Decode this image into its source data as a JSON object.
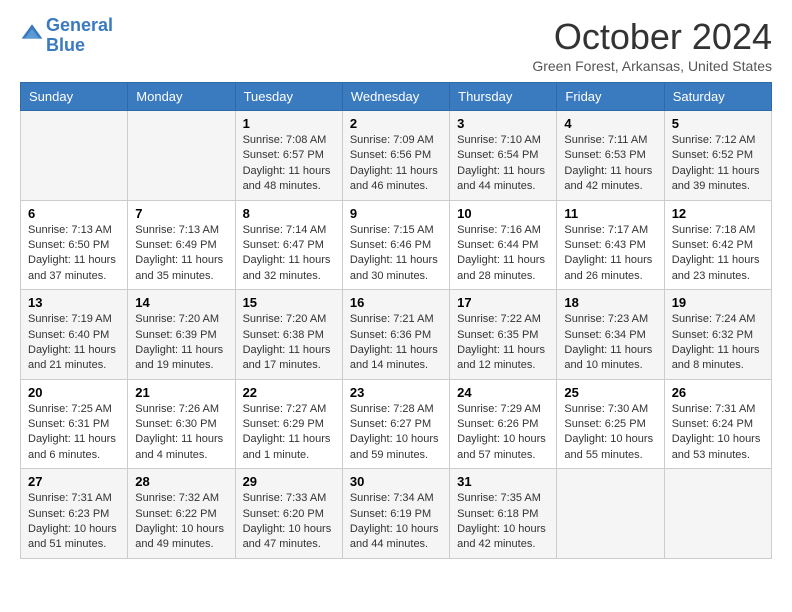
{
  "header": {
    "logo_line1": "General",
    "logo_line2": "Blue",
    "month_title": "October 2024",
    "location": "Green Forest, Arkansas, United States"
  },
  "days_of_week": [
    "Sunday",
    "Monday",
    "Tuesday",
    "Wednesday",
    "Thursday",
    "Friday",
    "Saturday"
  ],
  "weeks": [
    [
      {
        "day": "",
        "info": ""
      },
      {
        "day": "",
        "info": ""
      },
      {
        "day": "1",
        "info": "Sunrise: 7:08 AM\nSunset: 6:57 PM\nDaylight: 11 hours and 48 minutes."
      },
      {
        "day": "2",
        "info": "Sunrise: 7:09 AM\nSunset: 6:56 PM\nDaylight: 11 hours and 46 minutes."
      },
      {
        "day": "3",
        "info": "Sunrise: 7:10 AM\nSunset: 6:54 PM\nDaylight: 11 hours and 44 minutes."
      },
      {
        "day": "4",
        "info": "Sunrise: 7:11 AM\nSunset: 6:53 PM\nDaylight: 11 hours and 42 minutes."
      },
      {
        "day": "5",
        "info": "Sunrise: 7:12 AM\nSunset: 6:52 PM\nDaylight: 11 hours and 39 minutes."
      }
    ],
    [
      {
        "day": "6",
        "info": "Sunrise: 7:13 AM\nSunset: 6:50 PM\nDaylight: 11 hours and 37 minutes."
      },
      {
        "day": "7",
        "info": "Sunrise: 7:13 AM\nSunset: 6:49 PM\nDaylight: 11 hours and 35 minutes."
      },
      {
        "day": "8",
        "info": "Sunrise: 7:14 AM\nSunset: 6:47 PM\nDaylight: 11 hours and 32 minutes."
      },
      {
        "day": "9",
        "info": "Sunrise: 7:15 AM\nSunset: 6:46 PM\nDaylight: 11 hours and 30 minutes."
      },
      {
        "day": "10",
        "info": "Sunrise: 7:16 AM\nSunset: 6:44 PM\nDaylight: 11 hours and 28 minutes."
      },
      {
        "day": "11",
        "info": "Sunrise: 7:17 AM\nSunset: 6:43 PM\nDaylight: 11 hours and 26 minutes."
      },
      {
        "day": "12",
        "info": "Sunrise: 7:18 AM\nSunset: 6:42 PM\nDaylight: 11 hours and 23 minutes."
      }
    ],
    [
      {
        "day": "13",
        "info": "Sunrise: 7:19 AM\nSunset: 6:40 PM\nDaylight: 11 hours and 21 minutes."
      },
      {
        "day": "14",
        "info": "Sunrise: 7:20 AM\nSunset: 6:39 PM\nDaylight: 11 hours and 19 minutes."
      },
      {
        "day": "15",
        "info": "Sunrise: 7:20 AM\nSunset: 6:38 PM\nDaylight: 11 hours and 17 minutes."
      },
      {
        "day": "16",
        "info": "Sunrise: 7:21 AM\nSunset: 6:36 PM\nDaylight: 11 hours and 14 minutes."
      },
      {
        "day": "17",
        "info": "Sunrise: 7:22 AM\nSunset: 6:35 PM\nDaylight: 11 hours and 12 minutes."
      },
      {
        "day": "18",
        "info": "Sunrise: 7:23 AM\nSunset: 6:34 PM\nDaylight: 11 hours and 10 minutes."
      },
      {
        "day": "19",
        "info": "Sunrise: 7:24 AM\nSunset: 6:32 PM\nDaylight: 11 hours and 8 minutes."
      }
    ],
    [
      {
        "day": "20",
        "info": "Sunrise: 7:25 AM\nSunset: 6:31 PM\nDaylight: 11 hours and 6 minutes."
      },
      {
        "day": "21",
        "info": "Sunrise: 7:26 AM\nSunset: 6:30 PM\nDaylight: 11 hours and 4 minutes."
      },
      {
        "day": "22",
        "info": "Sunrise: 7:27 AM\nSunset: 6:29 PM\nDaylight: 11 hours and 1 minute."
      },
      {
        "day": "23",
        "info": "Sunrise: 7:28 AM\nSunset: 6:27 PM\nDaylight: 10 hours and 59 minutes."
      },
      {
        "day": "24",
        "info": "Sunrise: 7:29 AM\nSunset: 6:26 PM\nDaylight: 10 hours and 57 minutes."
      },
      {
        "day": "25",
        "info": "Sunrise: 7:30 AM\nSunset: 6:25 PM\nDaylight: 10 hours and 55 minutes."
      },
      {
        "day": "26",
        "info": "Sunrise: 7:31 AM\nSunset: 6:24 PM\nDaylight: 10 hours and 53 minutes."
      }
    ],
    [
      {
        "day": "27",
        "info": "Sunrise: 7:31 AM\nSunset: 6:23 PM\nDaylight: 10 hours and 51 minutes."
      },
      {
        "day": "28",
        "info": "Sunrise: 7:32 AM\nSunset: 6:22 PM\nDaylight: 10 hours and 49 minutes."
      },
      {
        "day": "29",
        "info": "Sunrise: 7:33 AM\nSunset: 6:20 PM\nDaylight: 10 hours and 47 minutes."
      },
      {
        "day": "30",
        "info": "Sunrise: 7:34 AM\nSunset: 6:19 PM\nDaylight: 10 hours and 44 minutes."
      },
      {
        "day": "31",
        "info": "Sunrise: 7:35 AM\nSunset: 6:18 PM\nDaylight: 10 hours and 42 minutes."
      },
      {
        "day": "",
        "info": ""
      },
      {
        "day": "",
        "info": ""
      }
    ]
  ]
}
